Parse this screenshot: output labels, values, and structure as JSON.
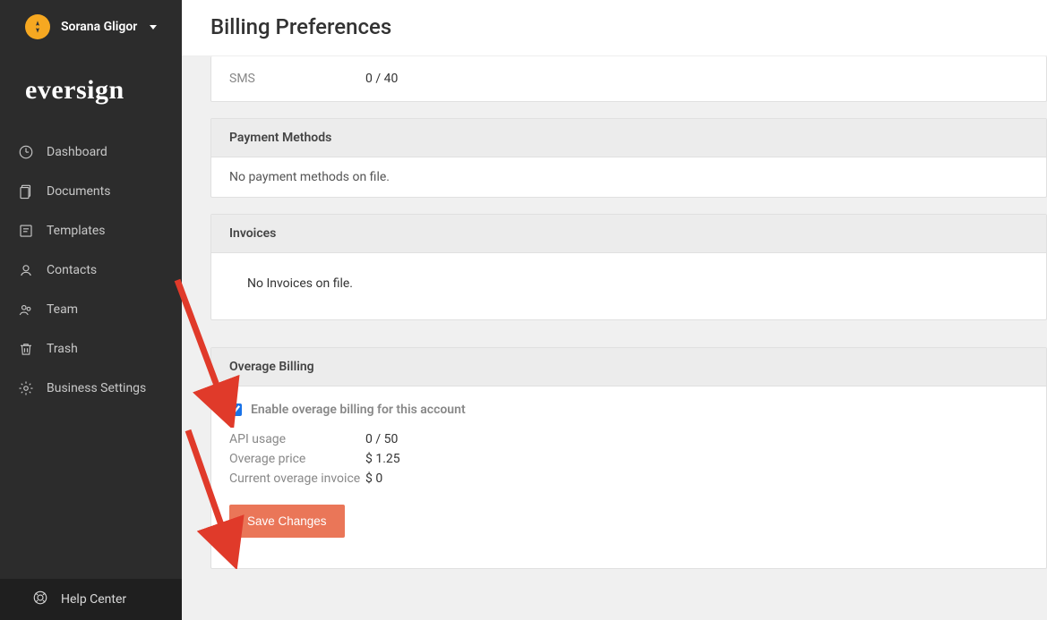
{
  "user": {
    "name": "Sorana Gligor"
  },
  "brand": "eversign",
  "nav": [
    {
      "label": "Dashboard"
    },
    {
      "label": "Documents"
    },
    {
      "label": "Templates"
    },
    {
      "label": "Contacts"
    },
    {
      "label": "Team"
    },
    {
      "label": "Trash"
    },
    {
      "label": "Business Settings"
    }
  ],
  "help": "Help Center",
  "page": {
    "title": "Billing Preferences"
  },
  "sms": {
    "label": "SMS",
    "value": "0 / 40"
  },
  "payment": {
    "heading": "Payment Methods",
    "empty": "No payment methods on file."
  },
  "invoices": {
    "heading": "Invoices",
    "empty": "No Invoices on file."
  },
  "overage": {
    "heading": "Overage Billing",
    "checkbox_label": "Enable overage billing for this account",
    "checked": true,
    "rows": {
      "api_usage_label": "API usage",
      "api_usage_value": "0 / 50",
      "price_label": "Overage price",
      "price_value": "$ 1.25",
      "invoice_label": "Current overage invoice",
      "invoice_value": "$ 0"
    },
    "save_label": "Save Changes"
  }
}
